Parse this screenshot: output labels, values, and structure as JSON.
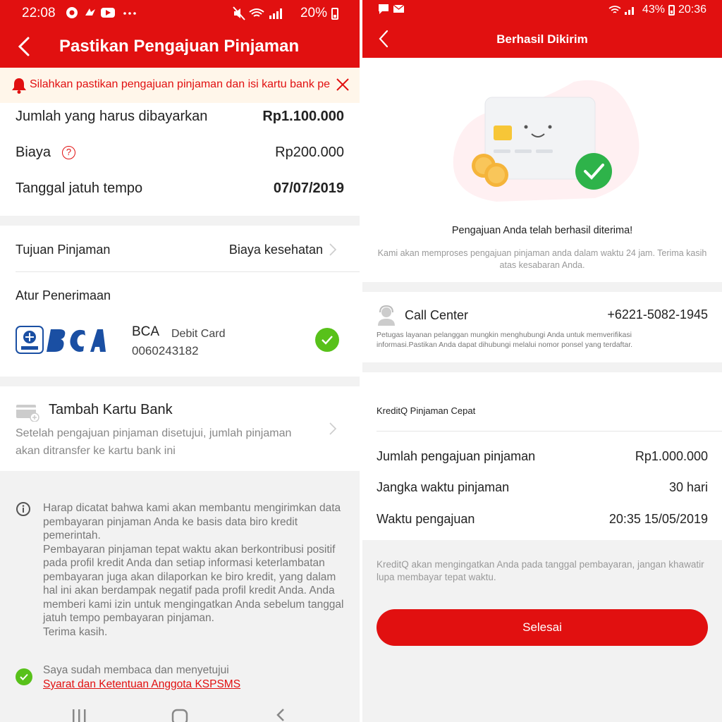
{
  "left": {
    "status_bar": {
      "time": "22:08",
      "battery": "20%"
    },
    "app_bar": {
      "title": "Pastikan Pengajuan Pinjaman"
    },
    "notice": {
      "text": "Silahkan pastikan pengajuan pinjaman dan isi kartu bank pe"
    },
    "summary": {
      "rows": [
        {
          "label": "Jumlah yang harus dibayarkan",
          "value": "Rp1.100.000"
        },
        {
          "label": "Biaya",
          "value": "Rp200.000",
          "help_icon": "?"
        },
        {
          "label": "Tanggal jatuh tempo",
          "value": "07/07/2019"
        }
      ]
    },
    "purpose": {
      "label": "Tujuan Pinjaman",
      "value": "Biaya kesehatan"
    },
    "receiving": {
      "label": "Atur Penerimaan",
      "bank_name": "BCA",
      "card_type": "Debit Card",
      "account_number": "0060243182"
    },
    "add_card": {
      "title": "Tambah Kartu Bank",
      "description": "Setelah pengajuan pinjaman disetujui, jumlah pinjaman akan ditransfer ke kartu bank ini"
    },
    "info": {
      "paragraphs": [
        "Harap dicatat bahwa kami akan membantu mengirimkan data pembayaran pinjaman Anda ke basis data biro kredit pemerintah.",
        "Pembayaran pinjaman tepat waktu akan berkontribusi positif pada profil kredit Anda dan setiap informasi keterlambatan pembayaran juga akan dilaporkan ke biro kredit, yang dalam hal ini akan berdampak negatif pada profil kredit Anda. Anda memberi kami izin untuk mengingatkan Anda sebelum tanggal jatuh tempo pembayaran pinjaman.",
        "Terima kasih."
      ]
    },
    "agreement": {
      "text": "Saya sudah membaca dan menyetujui",
      "link": "Syarat dan Ketentuan Anggota KSPSMS"
    }
  },
  "right": {
    "status_bar": {
      "battery": "43%",
      "time": "20:36"
    },
    "app_bar": {
      "title": "Berhasil Dikirim"
    },
    "success": {
      "heading": "Pengajuan Anda telah berhasil diterima!",
      "subtext": "Kami akan memproses pengajuan pinjaman anda dalam waktu 24 jam. Terima kasih atas kesabaran Anda."
    },
    "call_center": {
      "label": "Call Center",
      "number": "+6221-5082-1945",
      "description": "Petugas layanan pelanggan mungkin menghubungi Anda untuk memverifikasi informasi.Pastikan Anda dapat dihubungi melalui nomor ponsel yang terdaftar."
    },
    "loan": {
      "title": "KreditQ Pinjaman Cepat",
      "rows": [
        {
          "label": "Jumlah pengajuan pinjaman",
          "value": "Rp1.000.000"
        },
        {
          "label": "Jangka waktu pinjaman",
          "value": "30 hari"
        },
        {
          "label": "Waktu pengajuan",
          "value": "20:35 15/05/2019"
        }
      ]
    },
    "reminder": "KreditQ akan mengingatkan Anda pada tanggal pembayaran, jangan khawatir lupa membayar tepat waktu.",
    "done_button": "Selesai"
  },
  "icons": {
    "left_status": [
      "aperture-icon",
      "bird-icon",
      "youtube-icon",
      "more-dots-icon",
      "mute-icon",
      "wifi-icon",
      "signal-icon",
      "battery-icon"
    ],
    "right_status": [
      "chat-icon",
      "mail-icon",
      "wifi-icon",
      "signal-icon",
      "battery-icon"
    ]
  },
  "colors": {
    "brand_red": "#e11010",
    "success_green": "#58c11a",
    "notice_bg": "#fff6ea"
  }
}
